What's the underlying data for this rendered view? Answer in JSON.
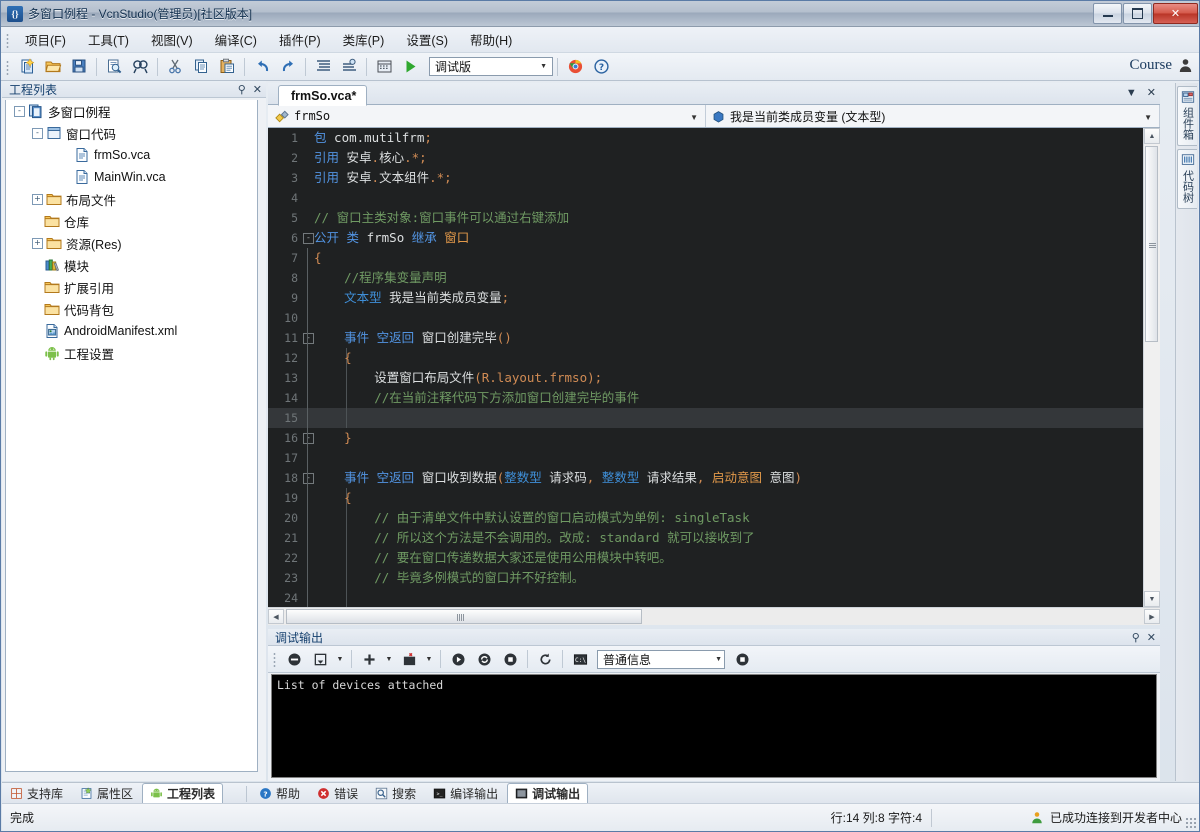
{
  "window": {
    "title": "多窗口例程 - VcnStudio(管理员)[社区版本]",
    "app_icon": "vcn-logo-icon",
    "minimize": "–",
    "maximize": "□",
    "close": "✕"
  },
  "menubar": {
    "items": [
      {
        "label": "项目(F)",
        "name": "menu-project"
      },
      {
        "label": "工具(T)",
        "name": "menu-tools"
      },
      {
        "label": "视图(V)",
        "name": "menu-view"
      },
      {
        "label": "编译(C)",
        "name": "menu-compile"
      },
      {
        "label": "插件(P)",
        "name": "menu-plugins"
      },
      {
        "label": "类库(P)",
        "name": "menu-classlib"
      },
      {
        "label": "设置(S)",
        "name": "menu-settings"
      },
      {
        "label": "帮助(H)",
        "name": "menu-help"
      }
    ]
  },
  "toolbar": {
    "build_config": "调试版",
    "build_config_arrow": "▼",
    "account_label": "Course",
    "buttons": [
      {
        "name": "new-project-icon"
      },
      {
        "name": "open-folder-icon"
      },
      {
        "name": "save-icon"
      },
      {
        "name": "print-preview-icon"
      },
      {
        "name": "find-icon"
      },
      {
        "name": "cut-icon"
      },
      {
        "name": "copy-icon"
      },
      {
        "name": "paste-icon"
      },
      {
        "name": "undo-icon"
      },
      {
        "name": "redo-icon"
      },
      {
        "name": "format-code-icon"
      },
      {
        "name": "comment-icon"
      },
      {
        "name": "build-icon"
      },
      {
        "name": "run-icon"
      },
      {
        "name": "chrome-icon"
      },
      {
        "name": "help-circle-icon"
      }
    ]
  },
  "project_panel": {
    "title": "工程列表",
    "pin": "⚲",
    "close": "✕",
    "tree": [
      {
        "label": "多窗口例程",
        "depth": 0,
        "toggle": "-",
        "icon": "project-icon"
      },
      {
        "label": "窗口代码",
        "depth": 1,
        "toggle": "-",
        "icon": "window-code-icon"
      },
      {
        "label": "frmSo.vca",
        "depth": 2,
        "toggle": "",
        "icon": "file-code-icon"
      },
      {
        "label": "MainWin.vca",
        "depth": 2,
        "toggle": "",
        "icon": "file-code-icon"
      },
      {
        "label": "布局文件",
        "depth": 1,
        "toggle": "+",
        "icon": "folder-icon"
      },
      {
        "label": "仓库",
        "depth": 1,
        "toggle": "",
        "icon": "folder-icon"
      },
      {
        "label": "资源(Res)",
        "depth": 1,
        "toggle": "+",
        "icon": "folder-icon"
      },
      {
        "label": "模块",
        "depth": 1,
        "toggle": "",
        "icon": "books-icon"
      },
      {
        "label": "扩展引用",
        "depth": 1,
        "toggle": "",
        "icon": "folder-icon"
      },
      {
        "label": "代码背包",
        "depth": 1,
        "toggle": "",
        "icon": "folder-icon"
      },
      {
        "label": "AndroidManifest.xml",
        "depth": 1,
        "toggle": "",
        "icon": "xml-file-icon"
      },
      {
        "label": "工程设置",
        "depth": 1,
        "toggle": "",
        "icon": "android-icon"
      }
    ]
  },
  "editor": {
    "tab_label": "frmSo.vca*",
    "tab_dropdown": "▼",
    "tab_close": "✕",
    "class_selector": "frmSo",
    "class_selector_icon": "class-icon",
    "member_selector": "我是当前类成员变量 (文本型)",
    "member_selector_icon": "variable-icon",
    "dropdown_arrow": "▼",
    "current_line": 15,
    "lines": [
      {
        "n": 1,
        "fold": "",
        "indent": 0,
        "tokens": [
          {
            "t": "包",
            "c": "k"
          },
          {
            "t": " com.mutilfrm",
            "c": "wh"
          },
          {
            "t": ";",
            "c": "or"
          }
        ]
      },
      {
        "n": 2,
        "fold": "",
        "indent": 0,
        "tokens": [
          {
            "t": "引用",
            "c": "k"
          },
          {
            "t": " 安卓",
            "c": "wh"
          },
          {
            "t": ".",
            "c": "or"
          },
          {
            "t": "核心",
            "c": "wh"
          },
          {
            "t": ".*;",
            "c": "or"
          }
        ]
      },
      {
        "n": 3,
        "fold": "",
        "indent": 0,
        "tokens": [
          {
            "t": "引用",
            "c": "k"
          },
          {
            "t": " 安卓",
            "c": "wh"
          },
          {
            "t": ".",
            "c": "or"
          },
          {
            "t": "文本组件",
            "c": "wh"
          },
          {
            "t": ".*;",
            "c": "or"
          }
        ]
      },
      {
        "n": 4,
        "fold": "",
        "indent": 0,
        "tokens": []
      },
      {
        "n": 5,
        "fold": "",
        "indent": 0,
        "tokens": [
          {
            "t": "// 窗口主类对象:窗口事件可以通过右键添加",
            "c": "cm"
          }
        ]
      },
      {
        "n": 6,
        "fold": "-",
        "indent": 0,
        "tokens": [
          {
            "t": "公开",
            "c": "k"
          },
          {
            "t": " ",
            "c": "wh"
          },
          {
            "t": "类",
            "c": "k"
          },
          {
            "t": " frmSo ",
            "c": "wh"
          },
          {
            "t": "继承",
            "c": "k"
          },
          {
            "t": " ",
            "c": "wh"
          },
          {
            "t": "窗口",
            "c": "ol"
          }
        ]
      },
      {
        "n": 7,
        "fold": "",
        "indent": 1,
        "tokens": [
          {
            "t": "{",
            "c": "or"
          }
        ]
      },
      {
        "n": 8,
        "fold": "",
        "indent": 1,
        "tokens": [
          {
            "t": "    //程序集变量声明",
            "c": "cm"
          }
        ]
      },
      {
        "n": 9,
        "fold": "",
        "indent": 1,
        "tokens": [
          {
            "t": "    ",
            "c": "wh"
          },
          {
            "t": "文本型",
            "c": "ty"
          },
          {
            "t": " 我是当前类成员变量",
            "c": "wh"
          },
          {
            "t": ";",
            "c": "or"
          }
        ]
      },
      {
        "n": 10,
        "fold": "",
        "indent": 1,
        "tokens": []
      },
      {
        "n": 11,
        "fold": "-",
        "indent": 1,
        "tokens": [
          {
            "t": "    ",
            "c": "wh"
          },
          {
            "t": "事件",
            "c": "k"
          },
          {
            "t": " ",
            "c": "wh"
          },
          {
            "t": "空返回",
            "c": "k"
          },
          {
            "t": " 窗口创建完毕",
            "c": "wh"
          },
          {
            "t": "()",
            "c": "or"
          }
        ]
      },
      {
        "n": 12,
        "fold": "",
        "indent": 2,
        "tokens": [
          {
            "t": "    ",
            "c": "wh"
          },
          {
            "t": "{",
            "c": "or"
          }
        ]
      },
      {
        "n": 13,
        "fold": "",
        "indent": 2,
        "tokens": [
          {
            "t": "        设置窗口布局文件",
            "c": "wh"
          },
          {
            "t": "(R.layout.frmso);",
            "c": "or"
          }
        ]
      },
      {
        "n": 14,
        "fold": "",
        "indent": 2,
        "tokens": [
          {
            "t": "        //在当前注释代码下方添加窗口创建完毕的事件",
            "c": "cm"
          }
        ]
      },
      {
        "n": 15,
        "fold": "",
        "indent": 2,
        "tokens": []
      },
      {
        "n": 16,
        "fold": "-",
        "indent": 1,
        "tokens": [
          {
            "t": "    ",
            "c": "wh"
          },
          {
            "t": "}",
            "c": "or"
          }
        ]
      },
      {
        "n": 17,
        "fold": "",
        "indent": 1,
        "tokens": []
      },
      {
        "n": 18,
        "fold": "-",
        "indent": 1,
        "tokens": [
          {
            "t": "    ",
            "c": "wh"
          },
          {
            "t": "事件",
            "c": "k"
          },
          {
            "t": " ",
            "c": "wh"
          },
          {
            "t": "空返回",
            "c": "k"
          },
          {
            "t": " 窗口收到数据",
            "c": "wh"
          },
          {
            "t": "(",
            "c": "or"
          },
          {
            "t": "整数型",
            "c": "ty"
          },
          {
            "t": " 请求码",
            "c": "wh"
          },
          {
            "t": ",",
            "c": "or"
          },
          {
            "t": " ",
            "c": "wh"
          },
          {
            "t": "整数型",
            "c": "ty"
          },
          {
            "t": " 请求结果",
            "c": "wh"
          },
          {
            "t": ",",
            "c": "or"
          },
          {
            "t": " ",
            "c": "wh"
          },
          {
            "t": "启动意图",
            "c": "ol"
          },
          {
            "t": " 意图",
            "c": "wh"
          },
          {
            "t": ")",
            "c": "or"
          }
        ]
      },
      {
        "n": 19,
        "fold": "",
        "indent": 2,
        "tokens": [
          {
            "t": "    ",
            "c": "wh"
          },
          {
            "t": "{",
            "c": "or"
          }
        ]
      },
      {
        "n": 20,
        "fold": "",
        "indent": 2,
        "tokens": [
          {
            "t": "        // 由于清单文件中默认设置的窗口启动模式为单例: singleTask",
            "c": "cm"
          }
        ]
      },
      {
        "n": 21,
        "fold": "",
        "indent": 2,
        "tokens": [
          {
            "t": "        // 所以这个方法是不会调用的。改成: standard 就可以接收到了",
            "c": "cm"
          }
        ]
      },
      {
        "n": 22,
        "fold": "",
        "indent": 2,
        "tokens": [
          {
            "t": "        // 要在窗口传递数据大家还是使用公用模块中转吧。",
            "c": "cm"
          }
        ]
      },
      {
        "n": 23,
        "fold": "",
        "indent": 2,
        "tokens": [
          {
            "t": "        // 毕竟多例模式的窗口并不好控制。",
            "c": "cm"
          }
        ]
      },
      {
        "n": 24,
        "fold": "",
        "indent": 2,
        "tokens": []
      }
    ]
  },
  "right_rail": {
    "tabs": [
      {
        "label": "组件箱",
        "icon": "component-box-icon",
        "name": "vtab-component-box"
      },
      {
        "label": "代码树",
        "icon": "code-tree-icon",
        "name": "vtab-code-tree"
      }
    ]
  },
  "debug_panel": {
    "title": "调试输出",
    "pin": "⚲",
    "close": "✕",
    "filter": "普通信息",
    "filter_arrow": "▼",
    "output": "List of devices attached",
    "buttons": [
      {
        "name": "clear-output-icon"
      },
      {
        "name": "save-log-icon"
      },
      {
        "name": "add-filter-icon"
      },
      {
        "name": "delete-filter-icon"
      },
      {
        "name": "start-icon"
      },
      {
        "name": "restart-icon"
      },
      {
        "name": "stop-icon"
      },
      {
        "name": "refresh-icon"
      },
      {
        "name": "console-icon"
      },
      {
        "name": "record-stop-icon"
      }
    ]
  },
  "bottom_tabs": {
    "left": [
      {
        "label": "支持库",
        "icon": "support-lib-icon",
        "active": false,
        "name": "bottom-tab-support-lib"
      },
      {
        "label": "属性区",
        "icon": "properties-icon",
        "active": false,
        "name": "bottom-tab-properties"
      },
      {
        "label": "工程列表",
        "icon": "android-icon",
        "active": true,
        "name": "bottom-tab-project-list"
      }
    ],
    "right": [
      {
        "label": "帮助",
        "icon": "help-circle-icon",
        "active": false,
        "name": "bottom-tab-help"
      },
      {
        "label": "错误",
        "icon": "error-icon",
        "active": false,
        "name": "bottom-tab-errors"
      },
      {
        "label": "搜索",
        "icon": "search-icon",
        "active": false,
        "name": "bottom-tab-search"
      },
      {
        "label": "编译输出",
        "icon": "console-icon",
        "active": false,
        "name": "bottom-tab-build-output"
      },
      {
        "label": "调试输出",
        "icon": "console-icon",
        "active": true,
        "name": "bottom-tab-debug-output"
      }
    ]
  },
  "statusbar": {
    "message": "完成",
    "position": "行:14 列:8 字符:4",
    "connection": "已成功连接到开发者中心",
    "connection_icon": "user-connected-icon"
  }
}
